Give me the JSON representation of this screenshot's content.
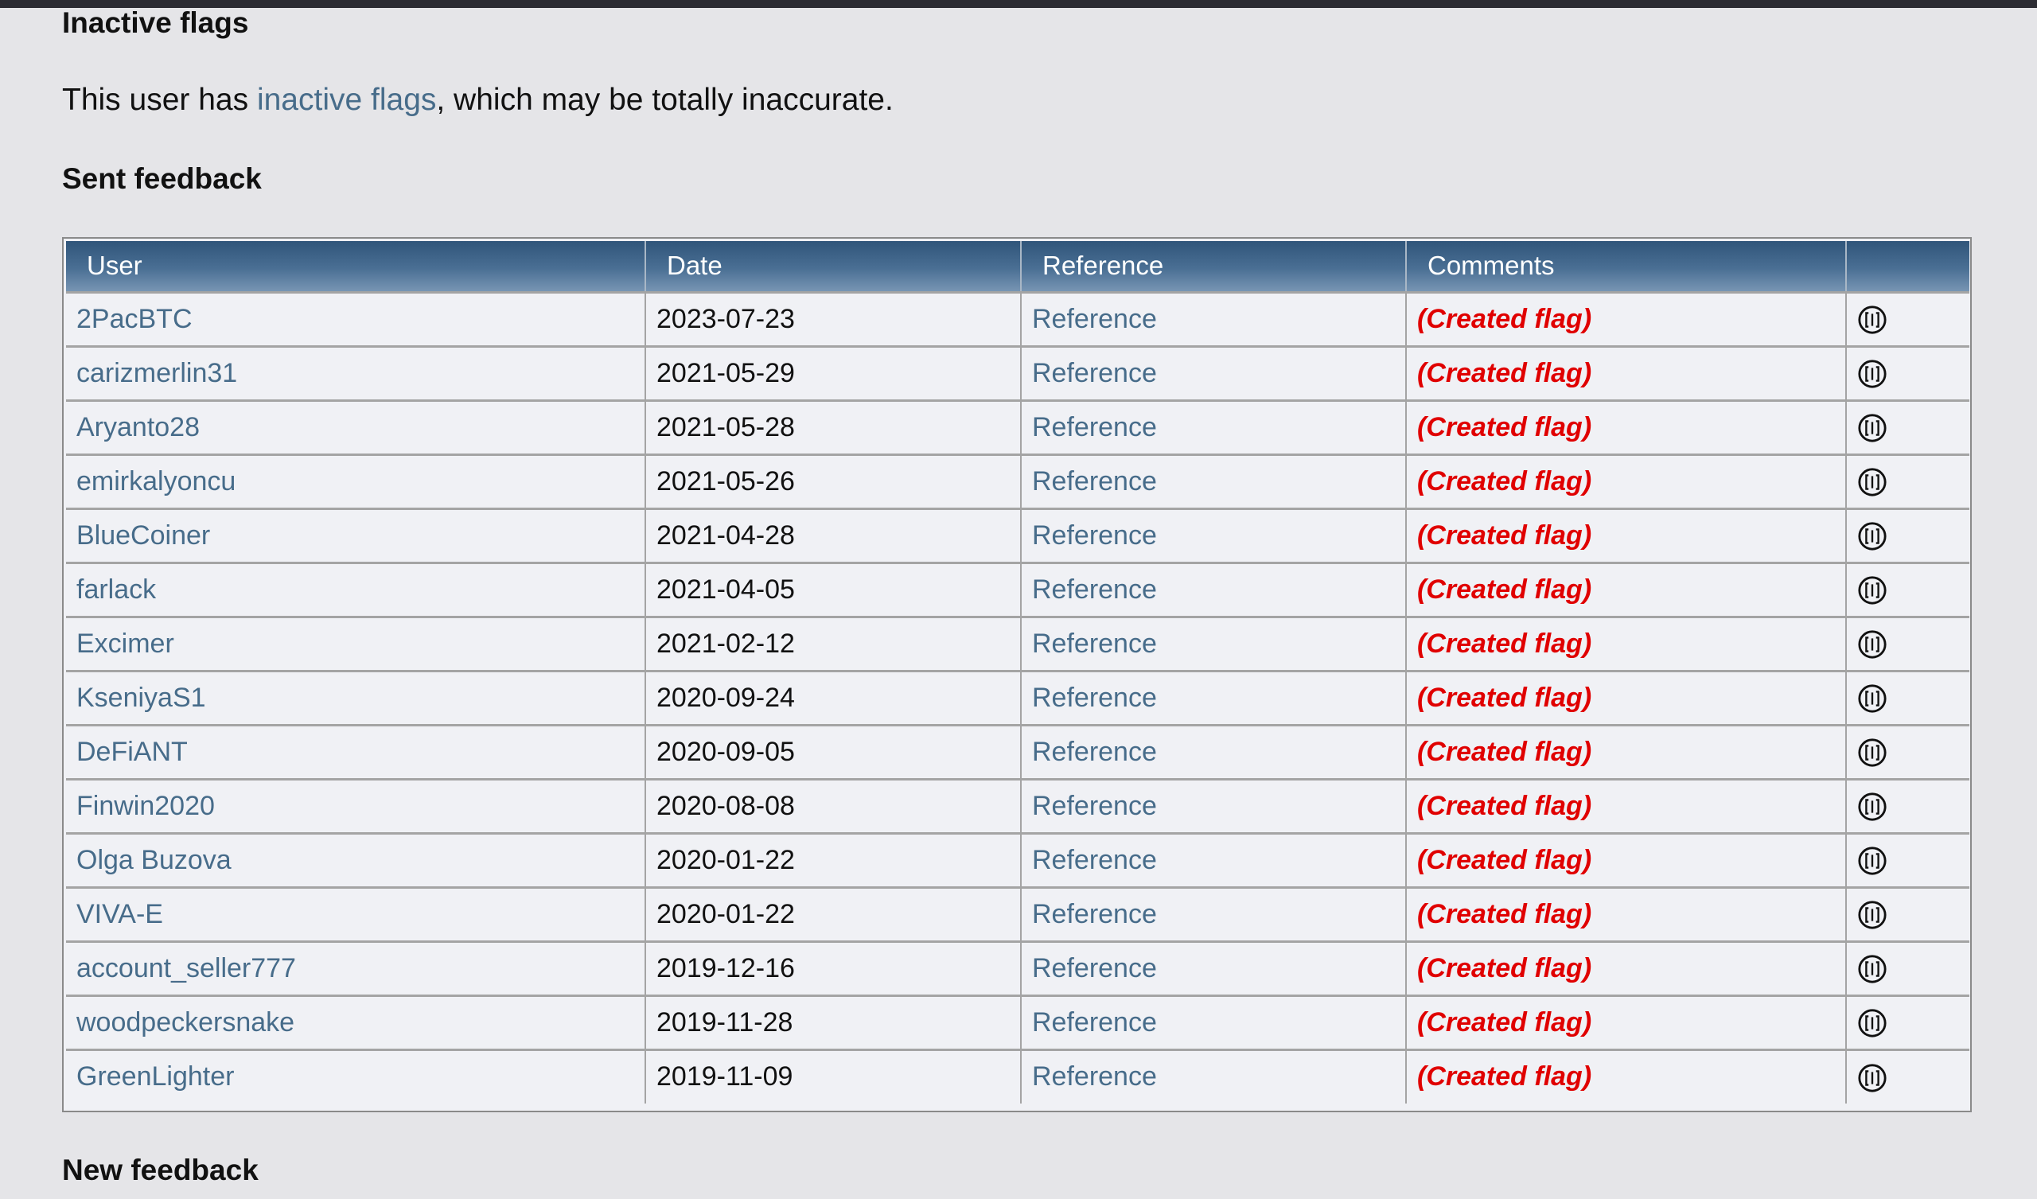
{
  "inactive_flags": {
    "heading": "Inactive flags",
    "intro_prefix": "This user has ",
    "intro_link": "inactive flags",
    "intro_suffix": ", which may be totally inaccurate."
  },
  "sent_feedback": {
    "heading": "Sent feedback",
    "columns": [
      "User",
      "Date",
      "Reference",
      "Comments",
      ""
    ],
    "rows": [
      {
        "user": "2PacBTC",
        "date": "2023-07-23",
        "reference": "Reference",
        "comment": "(Created flag)"
      },
      {
        "user": "carizmerlin31",
        "date": "2021-05-29",
        "reference": "Reference",
        "comment": "(Created flag)"
      },
      {
        "user": "Aryanto28",
        "date": "2021-05-28",
        "reference": "Reference",
        "comment": "(Created flag)"
      },
      {
        "user": "emirkalyoncu",
        "date": "2021-05-26",
        "reference": "Reference",
        "comment": "(Created flag)"
      },
      {
        "user": "BlueCoiner",
        "date": "2021-04-28",
        "reference": "Reference",
        "comment": "(Created flag)"
      },
      {
        "user": "farlack",
        "date": "2021-04-05",
        "reference": "Reference",
        "comment": "(Created flag)"
      },
      {
        "user": "Excimer",
        "date": "2021-02-12",
        "reference": "Reference",
        "comment": "(Created flag)"
      },
      {
        "user": "KseniyaS1",
        "date": "2020-09-24",
        "reference": "Reference",
        "comment": "(Created flag)"
      },
      {
        "user": "DeFiANT",
        "date": "2020-09-05",
        "reference": "Reference",
        "comment": "(Created flag)"
      },
      {
        "user": "Finwin2020",
        "date": "2020-08-08",
        "reference": "Reference",
        "comment": "(Created flag)"
      },
      {
        "user": "Olga Buzova",
        "date": "2020-01-22",
        "reference": "Reference",
        "comment": "(Created flag)"
      },
      {
        "user": "VIVA-E",
        "date": "2020-01-22",
        "reference": "Reference",
        "comment": "(Created flag)"
      },
      {
        "user": "account_seller777",
        "date": "2019-12-16",
        "reference": "Reference",
        "comment": "(Created flag)"
      },
      {
        "user": "woodpeckersnake",
        "date": "2019-11-28",
        "reference": "Reference",
        "comment": "(Created flag)"
      },
      {
        "user": "GreenLighter",
        "date": "2019-11-09",
        "reference": "Reference",
        "comment": "(Created flag)"
      }
    ],
    "row_icon": "info-circle-icon"
  },
  "new_feedback": {
    "heading": "New feedback"
  },
  "colors": {
    "link": "#476c8a",
    "comment": "#e00000",
    "header_bg": "#3a5f85"
  }
}
